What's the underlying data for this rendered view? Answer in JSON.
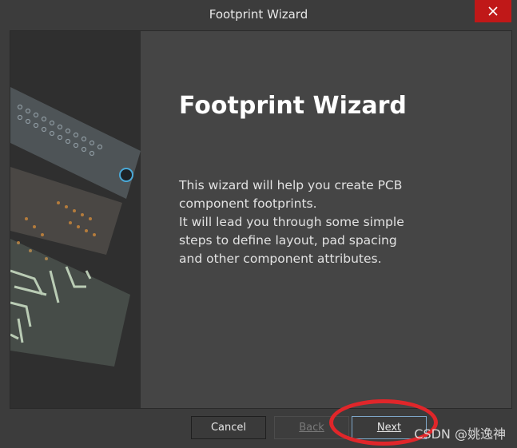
{
  "window": {
    "title": "Footprint Wizard",
    "close_glyph": "✕"
  },
  "wizard": {
    "heading": "Footprint Wizard",
    "description_lines": [
      "This wizard will help you create PCB component footprints.",
      "It will lead you through some simple steps to define layout, pad spacing and other component attributes."
    ]
  },
  "buttons": {
    "cancel": "Cancel",
    "back": "Back",
    "next": "Next"
  },
  "watermark": "CSDN @姚逸神",
  "colors": {
    "close_red": "#c01818",
    "annotation_red": "#e0262a",
    "focus_border": "#7fa7c9"
  },
  "icons": {
    "close": "close-icon"
  }
}
